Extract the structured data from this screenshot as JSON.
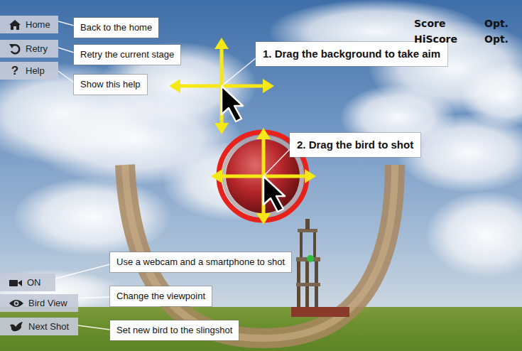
{
  "menu": [
    {
      "label": "Home",
      "hint": "Back to the home",
      "kind": "home"
    },
    {
      "label": "Retry",
      "hint": "Retry the current stage",
      "kind": "retry"
    },
    {
      "label": "Help",
      "hint": "Show this help",
      "kind": "help",
      "glyph": "?"
    }
  ],
  "bottom_menu": [
    {
      "label": "ON",
      "hint": "Use a webcam and a smartphone to shot",
      "kind": "camera"
    },
    {
      "label": "Bird View",
      "hint": "Change the viewpoint",
      "kind": "eye"
    },
    {
      "label": "Next Shot",
      "hint": "Set new bird to the slingshot",
      "kind": "bird"
    }
  ],
  "steps": [
    "1. Drag the background to take aim",
    "2. Drag the bird to shot"
  ],
  "score": {
    "label": "Score",
    "value": "Opt."
  },
  "hiscore": {
    "label": "HiScore",
    "value": "Opt."
  }
}
